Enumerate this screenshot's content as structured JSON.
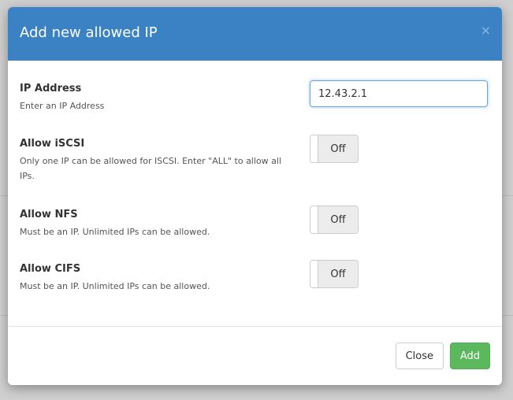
{
  "modal": {
    "title": "Add new allowed IP",
    "close_icon": "×"
  },
  "fields": {
    "ip_address": {
      "label": "IP Address",
      "help": "Enter an IP Address",
      "value": "12.43.2.1"
    },
    "allow_iscsi": {
      "label": "Allow iSCSI",
      "help": "Only one IP can be allowed for ISCSI. Enter \"ALL\" to allow all IPs.",
      "state": "Off"
    },
    "allow_nfs": {
      "label": "Allow NFS",
      "help": "Must be an IP. Unlimited IPs can be allowed.",
      "state": "Off"
    },
    "allow_cifs": {
      "label": "Allow CIFS",
      "help": "Must be an IP. Unlimited IPs can be allowed.",
      "state": "Off"
    }
  },
  "footer": {
    "close_label": "Close",
    "add_label": "Add"
  },
  "colors": {
    "header": "#3b82c4",
    "add_button": "#5cb85c"
  }
}
